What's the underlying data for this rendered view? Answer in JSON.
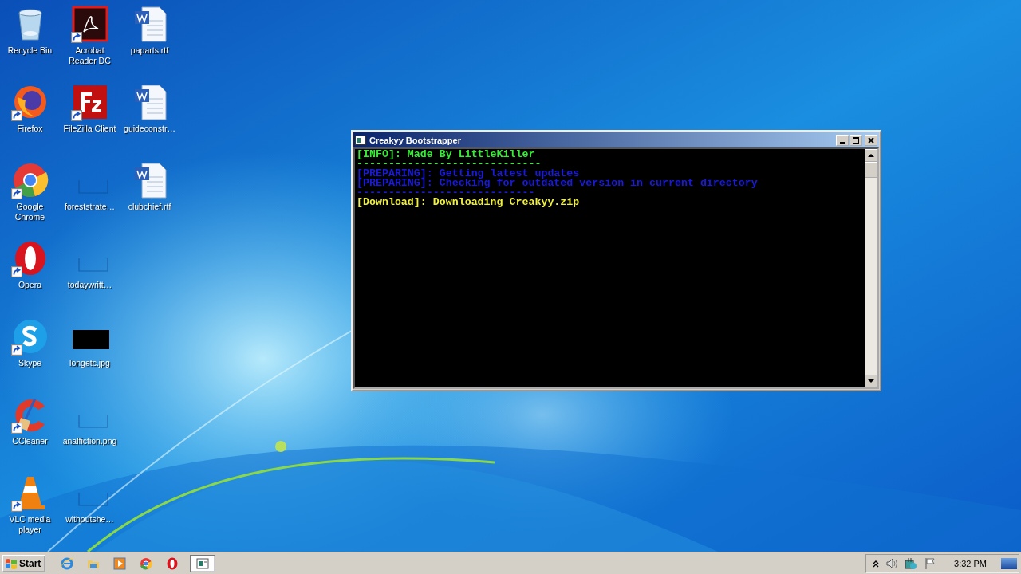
{
  "desktop_icons": [
    {
      "label": "Recycle Bin",
      "kind": "recycle",
      "shortcut": false
    },
    {
      "label": "Firefox",
      "kind": "firefox",
      "shortcut": true
    },
    {
      "label": "Google Chrome",
      "kind": "chrome",
      "shortcut": true
    },
    {
      "label": "Opera",
      "kind": "opera",
      "shortcut": true
    },
    {
      "label": "Skype",
      "kind": "skype",
      "shortcut": true
    },
    {
      "label": "CCleaner",
      "kind": "ccleaner",
      "shortcut": true
    },
    {
      "label": "VLC media player",
      "kind": "vlc",
      "shortcut": true
    },
    {
      "label": "Acrobat Reader DC",
      "kind": "acrobat",
      "shortcut": true
    },
    {
      "label": "FileZilla Client",
      "kind": "filezilla",
      "shortcut": true
    },
    {
      "label": "foreststrate…",
      "kind": "blank",
      "shortcut": false
    },
    {
      "label": "todaywritt…",
      "kind": "blank",
      "shortcut": false
    },
    {
      "label": "longetc.jpg",
      "kind": "black",
      "shortcut": false
    },
    {
      "label": "analfiction.png",
      "kind": "blank",
      "shortcut": false
    },
    {
      "label": "withoutshe…",
      "kind": "blank",
      "shortcut": false
    },
    {
      "label": "paparts.rtf",
      "kind": "word",
      "shortcut": false
    },
    {
      "label": "guideconstr…",
      "kind": "word",
      "shortcut": false
    },
    {
      "label": "clubchief.rtf",
      "kind": "word",
      "shortcut": false
    }
  ],
  "console_window": {
    "title": "Creakyy Bootstrapper",
    "lines": [
      {
        "text": "[INFO]: Made By LittleKiller",
        "color": "#33ee33"
      },
      {
        "text": "-----------------------------",
        "color": "#33ee33"
      },
      {
        "text": "[PREPARING]: Getting latest updates",
        "color": "#1a1ad8"
      },
      {
        "text": "[PREPARING]: Checking for outdated version in current directory",
        "color": "#1a1ad8"
      },
      {
        "text": "----------------------------",
        "color": "#1a1ad8"
      },
      {
        "text": "[Download]: Downloading Creakyy.zip",
        "color": "#f0f040"
      }
    ]
  },
  "taskbar": {
    "start_label": "Start",
    "items": [
      {
        "kind": "ie",
        "selected": false
      },
      {
        "kind": "folder",
        "selected": false
      },
      {
        "kind": "media",
        "selected": false
      },
      {
        "kind": "chrome",
        "selected": false
      },
      {
        "kind": "opera",
        "selected": false
      },
      {
        "kind": "console",
        "selected": true
      }
    ],
    "tray": {
      "clock": "3:32 PM"
    }
  }
}
